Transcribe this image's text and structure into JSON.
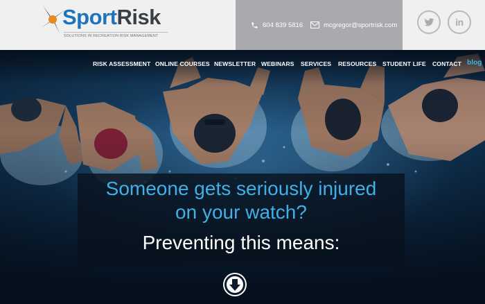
{
  "brand": {
    "name_part1": "Sport",
    "name_part2": "Risk",
    "tagline": "Solutions in Recreation Risk Management",
    "accent_color": "#1e73be"
  },
  "contact": {
    "phone": "604 839 5816",
    "email": "mcgregor@sportrisk.com",
    "phone_icon": "phone-icon",
    "email_icon": "envelope-icon"
  },
  "social": [
    {
      "icon": "twitter-icon"
    },
    {
      "icon": "linkedin-icon",
      "label": "in"
    }
  ],
  "nav": {
    "items": [
      {
        "label": "RISK ASSESSMENT"
      },
      {
        "label": "ONLINE COURSES"
      },
      {
        "label": "NEWSLETTER"
      },
      {
        "label": "WEBINARS"
      },
      {
        "label": "SERVICES"
      },
      {
        "label": "RESOURCES"
      },
      {
        "label": "STUDENT LIFE"
      },
      {
        "label": "CONTACT"
      },
      {
        "label": "blog",
        "active": true
      }
    ],
    "active_color": "#39b3e6"
  },
  "hero": {
    "line1": "Someone gets seriously injured",
    "line2": "on your watch?",
    "line3": "Preventing this means:",
    "scroll_icon": "arrow-down-circle-icon"
  }
}
